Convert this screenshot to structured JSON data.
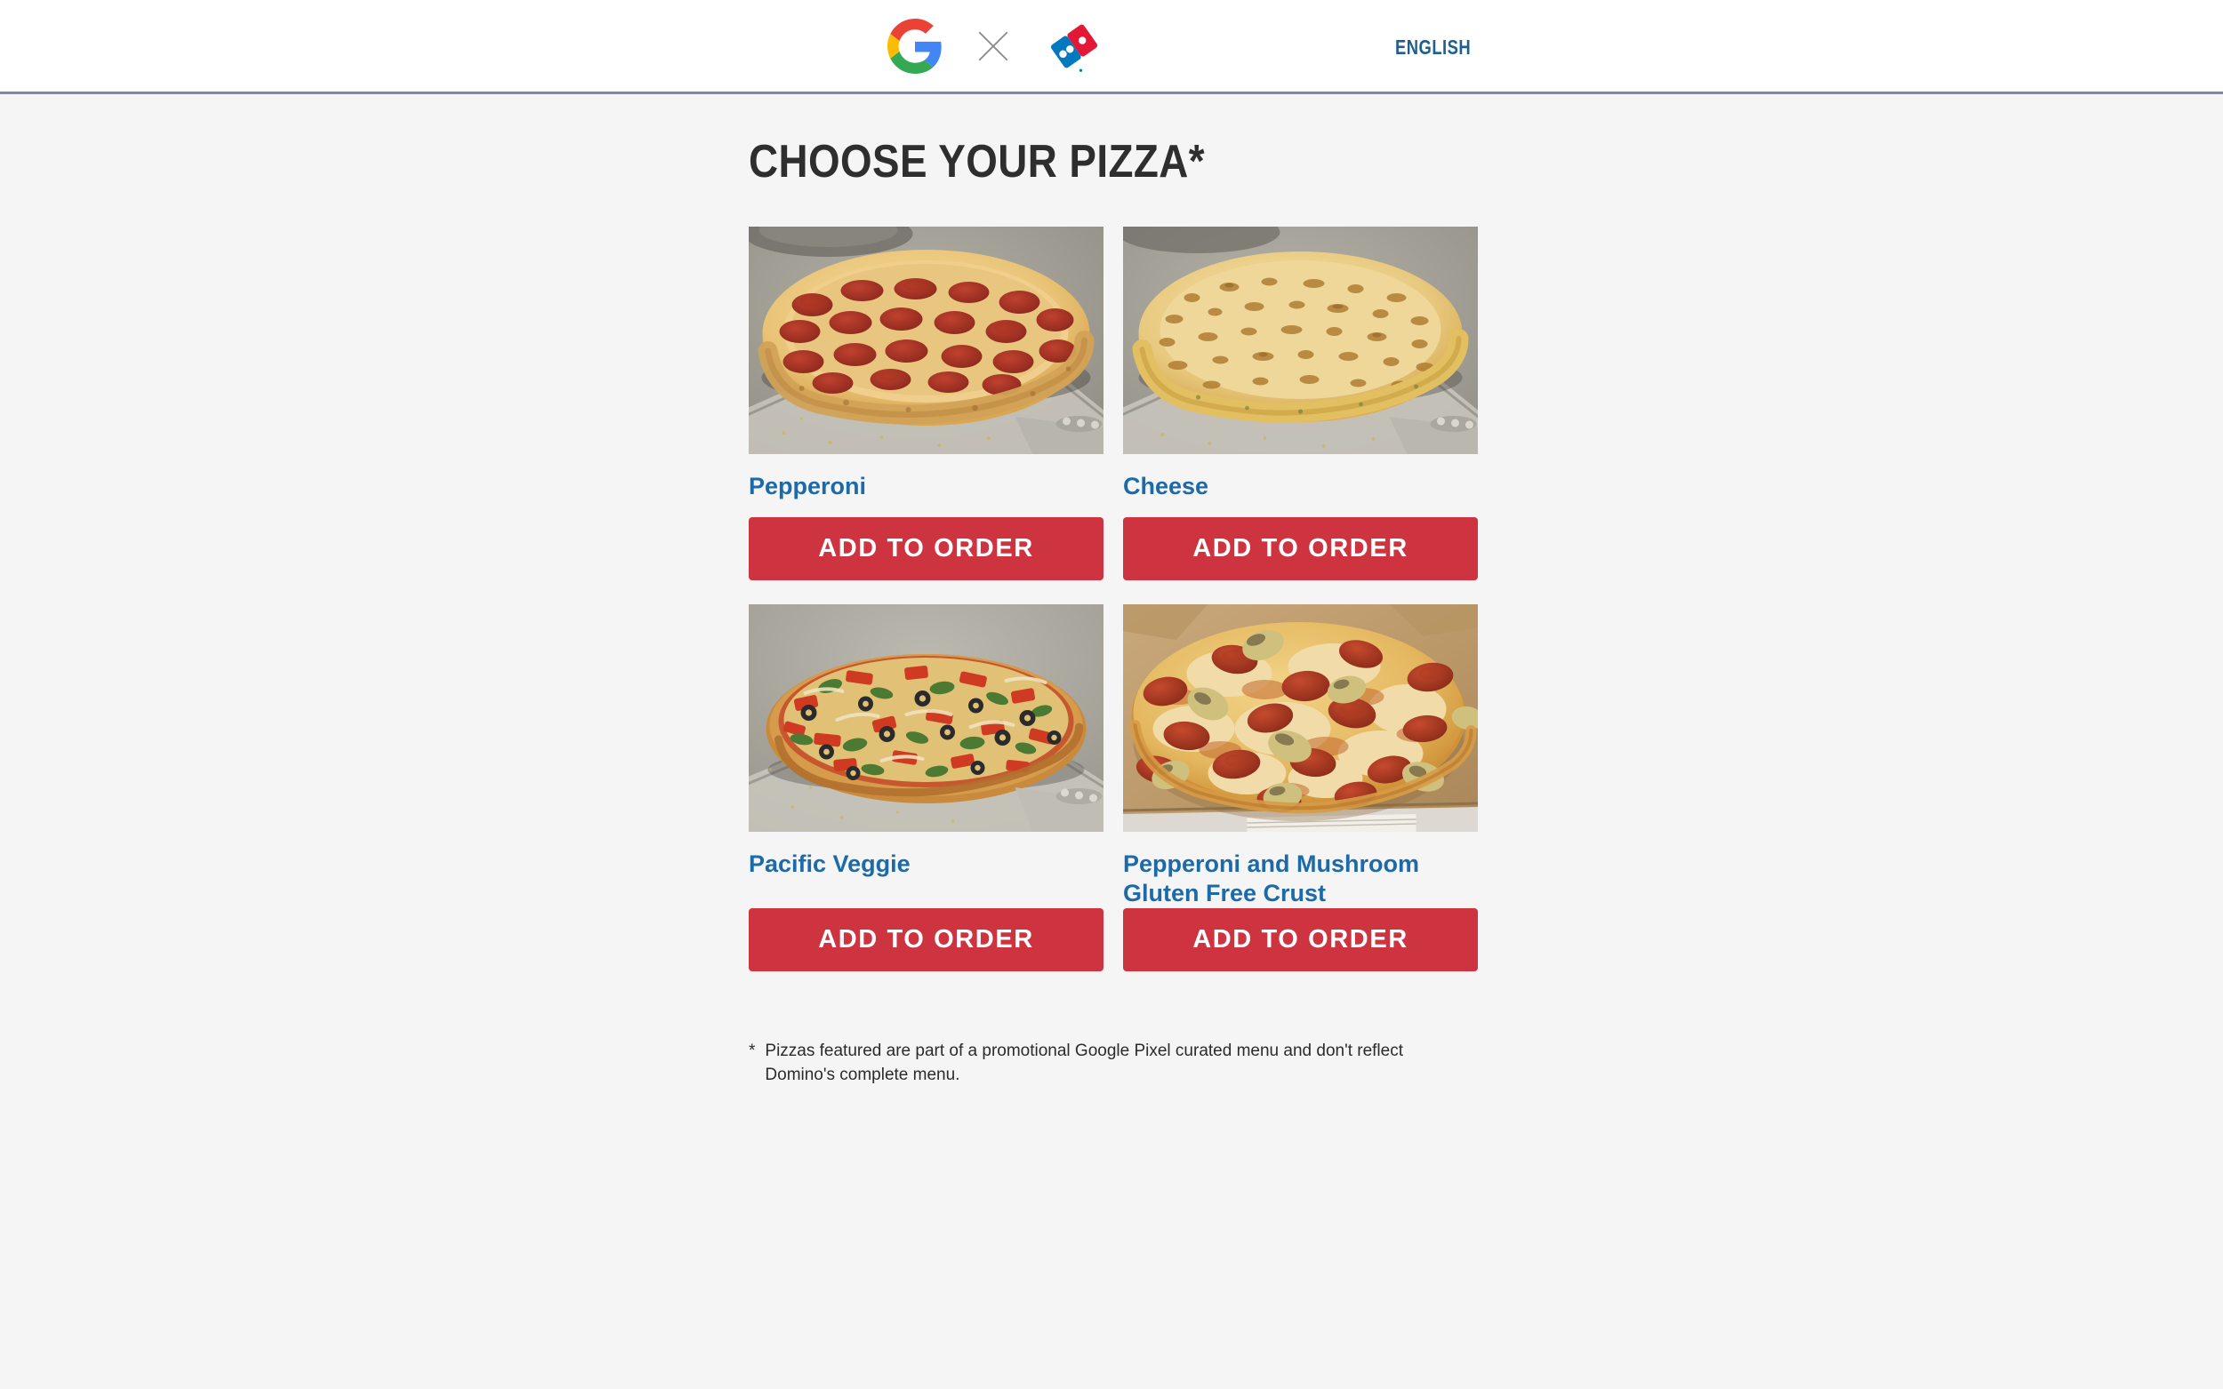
{
  "header": {
    "google_logo_alt": "Google",
    "separator_icon": "close-x-icon",
    "dominos_logo_alt": "Domino's Pizza",
    "language_label": "ENGLISH"
  },
  "main": {
    "title": "CHOOSE YOUR PIZZA*",
    "pizzas": [
      {
        "name": "Pepperoni",
        "button_label": "ADD TO ORDER",
        "image": "pepperoni-pizza-on-metal-pan"
      },
      {
        "name": "Cheese",
        "button_label": "ADD TO ORDER",
        "image": "cheese-pizza-on-metal-pan"
      },
      {
        "name": "Pacific Veggie",
        "button_label": "ADD TO ORDER",
        "image": "pacific-veggie-thin-crust-pizza"
      },
      {
        "name": "Pepperoni and Mushroom Gluten Free Crust",
        "button_label": "ADD TO ORDER",
        "image": "pepperoni-mushroom-pizza-in-box"
      }
    ]
  },
  "footnote": {
    "marker": "*",
    "text": "Pizzas featured are part of a promotional Google Pixel curated menu and don't reflect Domino's complete menu."
  },
  "colors": {
    "button_red": "#ce3340",
    "link_blue": "#1d6aa8",
    "header_border": "#7c8ca6",
    "page_background": "#f5f5f5",
    "title_text": "#2e2e2e"
  }
}
